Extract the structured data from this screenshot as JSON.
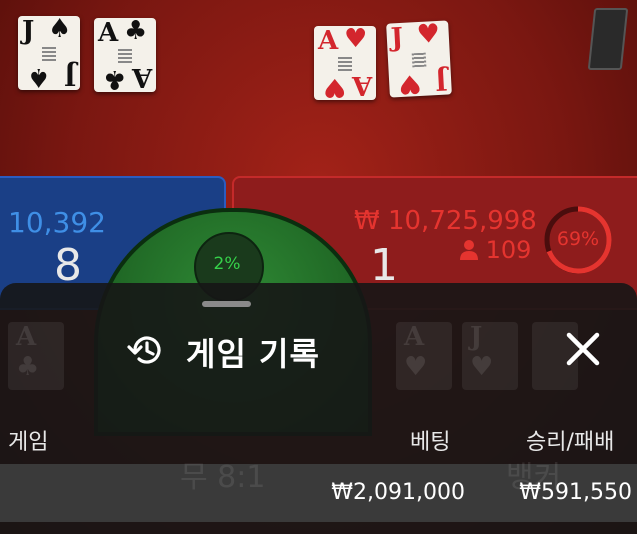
{
  "table": {
    "player_cards": [
      {
        "rank": "J",
        "suit": "♠",
        "color": "black"
      },
      {
        "rank": "A",
        "suit": "♣",
        "color": "black"
      }
    ],
    "banker_cards": [
      {
        "rank": "A",
        "suit": "♥",
        "color": "red"
      },
      {
        "rank": "J",
        "suit": "♥",
        "color": "red"
      }
    ],
    "player": {
      "amount": "10,392",
      "score": "8"
    },
    "banker": {
      "amount": "₩ 10,725,998",
      "users": "109",
      "score": "1",
      "percent": "69%",
      "percent_value": 0.69
    },
    "tie": {
      "percent": "2%",
      "payout_ghost": "무 8:1"
    },
    "banker_ghost": "뱅커"
  },
  "sheet": {
    "title": "게임 기록",
    "columns": {
      "game": "게임",
      "bet": "베팅",
      "result": "승리/패배"
    },
    "rows": [
      {
        "bet": "₩2,091,000",
        "result": "₩591,550"
      }
    ]
  },
  "colors": {
    "player_blue": "#3f8fe6",
    "banker_red": "#e5342f",
    "tie_green": "#36d14a"
  },
  "icons": {
    "history": "history-icon",
    "close": "close-icon",
    "user": "user-icon"
  }
}
